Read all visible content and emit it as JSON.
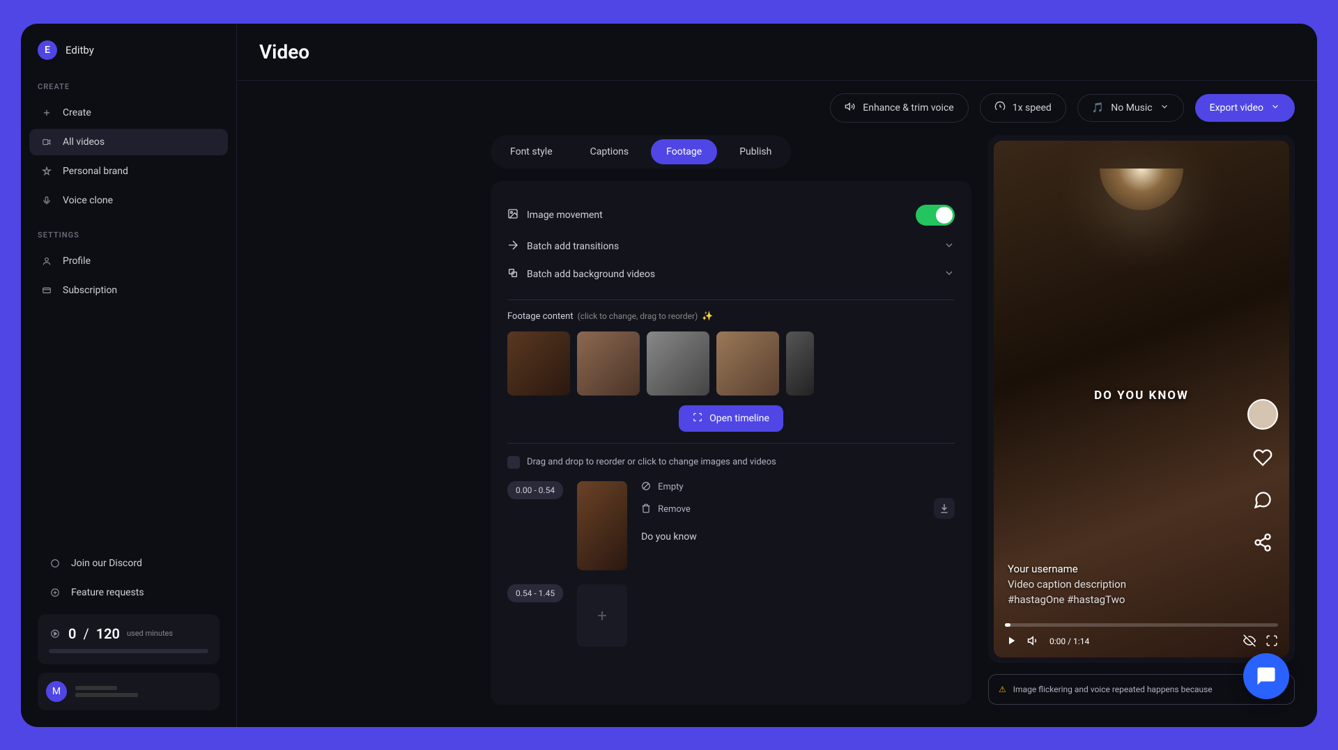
{
  "app": {
    "logo_letter": "E",
    "logo_text": "Editby"
  },
  "sidebar": {
    "create_label": "CREATE",
    "settings_label": "SETTINGS",
    "items": {
      "create": "Create",
      "all_videos": "All videos",
      "personal_brand": "Personal brand",
      "voice_clone": "Voice clone",
      "profile": "Profile",
      "subscription": "Subscription",
      "discord": "Join our Discord",
      "feature_requests": "Feature requests"
    },
    "usage": {
      "used": "0",
      "sep": "/",
      "total": "120",
      "unit": "used minutes"
    },
    "user_letter": "M"
  },
  "page": {
    "title": "Video"
  },
  "toolbar": {
    "enhance": "Enhance & trim voice",
    "speed": "1x speed",
    "music_icon": "🎵",
    "music": "No Music",
    "export": "Export video"
  },
  "tabs": {
    "font": "Font style",
    "captions": "Captions",
    "footage": "Footage",
    "publish": "Publish"
  },
  "settings": {
    "image_movement": "Image movement",
    "batch_transitions": "Batch add transitions",
    "batch_bg": "Batch add background videos"
  },
  "footage": {
    "title": "Footage content",
    "hint": "(click to change, drag to reorder)",
    "open_timeline": "Open timeline",
    "drag_hint": "Drag and drop to reorder or click to change images and videos"
  },
  "clips": [
    {
      "time": "0.00 - 0.54",
      "empty": "Empty",
      "remove": "Remove",
      "text": "Do you know"
    },
    {
      "time": "0.54 - 1.45"
    }
  ],
  "preview": {
    "caption": "DO YOU KNOW",
    "username": "Your username",
    "desc": "Video caption description",
    "tags": "#hastagOne #hastagTwo",
    "time": "0:00 / 1:14"
  },
  "warning": "Image flickering and voice repeated happens because"
}
